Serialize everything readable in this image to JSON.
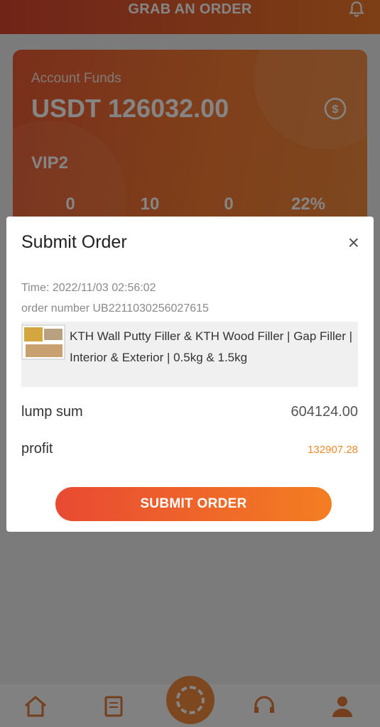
{
  "header": {
    "title": "GRAB AN ORDER",
    "bell_icon": "bell-icon"
  },
  "card": {
    "account_label": "Account Funds",
    "account_value": "USDT 126032.00",
    "vip": "VIP2",
    "stats": [
      "0",
      "10",
      "0",
      "22%"
    ]
  },
  "modal": {
    "title": "Submit Order",
    "close": "×",
    "time_label": "Time:",
    "time_value": "2022/11/03 02:56:02",
    "order_number_label": "order number",
    "order_number_value": "UB2211030256027615",
    "product_name": "KTH Wall Putty Filler & KTH Wood Filler | Gap Filler | Interior & Exterior | 0.5kg & 1.5kg",
    "lump_sum_label": "lump sum",
    "lump_sum_value": "604124.00",
    "profit_label": "profit",
    "profit_value": "132907.28",
    "submit_label": "SUBMIT ORDER"
  },
  "colors": {
    "accent": "#f08a2a",
    "header_start": "#d7452f",
    "header_end": "#f07a2a"
  },
  "nav": {
    "icons": [
      "home-icon",
      "orders-icon",
      "grab-icon",
      "support-icon",
      "profile-icon"
    ]
  }
}
